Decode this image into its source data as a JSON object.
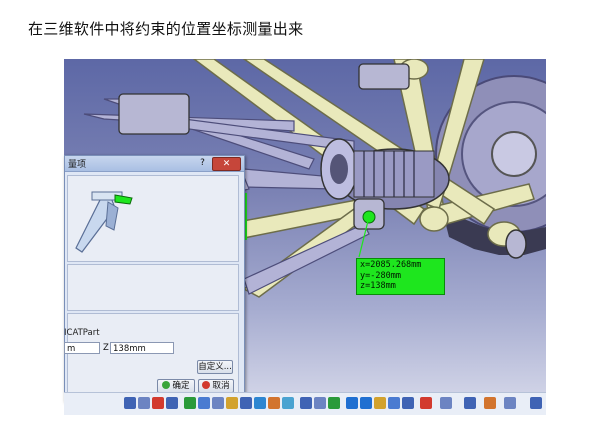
{
  "caption": "在三维软件中将约束的位置坐标测量出来",
  "measurement": {
    "x": "x=2085.268mm",
    "y": "y=-280mm",
    "z": "z=138mm"
  },
  "dialog": {
    "title": "量项",
    "help_label": "?",
    "close_label": "✕",
    "part_name": "ICATPart",
    "field_left_value": "m",
    "z_label": "Z",
    "z_value": "138mm",
    "customize_label": "自定义...",
    "ok_label": "确定",
    "cancel_label": "取消"
  },
  "colors": {
    "highlight": "#1ee61e",
    "frame": "#e6e6b4",
    "background": "#6e77b0"
  },
  "toolbar_icons": [
    "tool-icon",
    "tool-icon",
    "tool-icon",
    "tool-icon",
    "tool-icon",
    "tool-icon",
    "tool-icon",
    "tool-icon",
    "tool-icon",
    "tool-icon",
    "tool-icon",
    "tool-icon",
    "tool-icon",
    "tool-icon",
    "tool-icon",
    "tool-icon",
    "tool-icon",
    "tool-icon",
    "tool-icon",
    "tool-icon",
    "tool-icon",
    "tool-icon",
    "tool-icon",
    "tool-icon",
    "tool-icon",
    "tool-icon",
    "tool-icon",
    "tool-icon",
    "tool-icon",
    "tool-icon",
    "tool-icon",
    "tool-icon"
  ]
}
